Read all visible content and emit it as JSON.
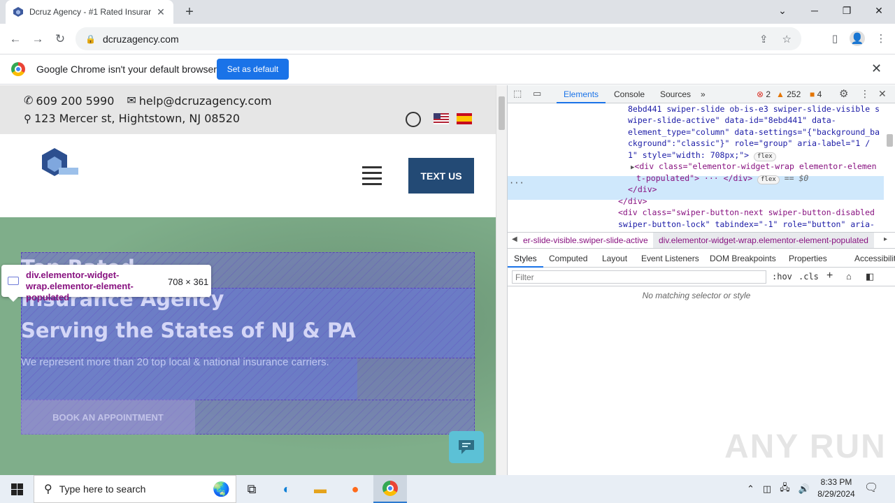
{
  "browser": {
    "tab_title": "Dcruz Agency - #1 Rated Insurar",
    "tab_close": "✕",
    "new_tab": "+",
    "url": "dcruzagency.com",
    "window": {
      "minimize": "─",
      "restore": "❐",
      "close": "✕",
      "dropdown": "⌄"
    }
  },
  "infobar": {
    "message": "Google Chrome isn't your default browser",
    "button": "Set as default",
    "close": "✕"
  },
  "site": {
    "phone": "609 200 5990",
    "email": "help@dcruzagency.com",
    "address": "123 Mercer st, Hightstown, NJ 08520",
    "text_us": "TEXT US",
    "hero_line1": "Top Rated",
    "hero_line2": "Insurance Agency",
    "hero_line3": "Serving the States of NJ & PA",
    "hero_sub": "We represent more than 20 top local & national insurance carriers.",
    "cta": "BOOK AN APPOINTMENT"
  },
  "inspect_tooltip": {
    "selector": "div.elementor-widget-wrap.elementor-element-populated",
    "dims": "708 × 361"
  },
  "devtools": {
    "tabs": [
      "Elements",
      "Console",
      "Sources",
      "»"
    ],
    "errors": "2",
    "warnings": "252",
    "issues": "4",
    "dom_lines": [
      "8ebd441 swiper-slide ob-is-e3 swiper-slide-visible s",
      "wiper-slide-active\" data-id=\"8ebd441\" data-",
      "element_type=\"column\" data-settings=\"{\"background_ba",
      "ckground\":\"classic\"}\" role=\"group\" aria-label=\"1 /",
      "1\" style=\"width: 708px;\">",
      "<div class=\"elementor-widget-wrap elementor-elemen",
      "t-populated\"> ··· </div>",
      "</div>",
      "</div>",
      "<div class=\"swiper-button-next swiper-button-disabled",
      "swiper-button-lock\" tabindex=\"-1\" role=\"button\" aria-"
    ],
    "flex_pill": "flex",
    "dollar0": "== $0",
    "crumb_prev": "er-slide-visible.swiper-slide-active",
    "crumb_current": "div.elementor-widget-wrap.elementor-element-populated",
    "subtabs": [
      "Styles",
      "Computed",
      "Layout",
      "Event Listeners",
      "DOM Breakpoints",
      "Properties",
      "Accessibility"
    ],
    "filter_placeholder": "Filter",
    "hov": ":hov",
    "cls": ".cls",
    "no_match": "No matching selector or style"
  },
  "taskbar": {
    "search_placeholder": "Type here to search",
    "time": "8:33 PM",
    "date": "8/29/2024"
  },
  "watermark": "ANY RUN"
}
